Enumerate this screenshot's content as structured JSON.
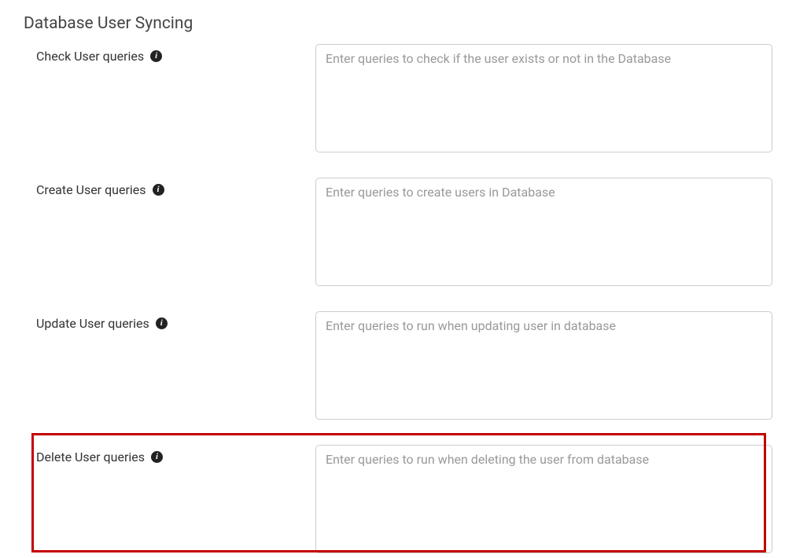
{
  "section": {
    "title": "Database User Syncing"
  },
  "fields": {
    "check": {
      "label": "Check User queries",
      "placeholder": "Enter queries to check if the user exists or not in the Database",
      "info_icon": "i"
    },
    "create": {
      "label": "Create User queries",
      "placeholder": "Enter queries to create users in Database",
      "info_icon": "i"
    },
    "update": {
      "label": "Update User queries",
      "placeholder": "Enter queries to run when updating user in database",
      "info_icon": "i"
    },
    "delete": {
      "label": "Delete User queries",
      "placeholder": "Enter queries to run when deleting the user from database",
      "info_icon": "i"
    }
  }
}
